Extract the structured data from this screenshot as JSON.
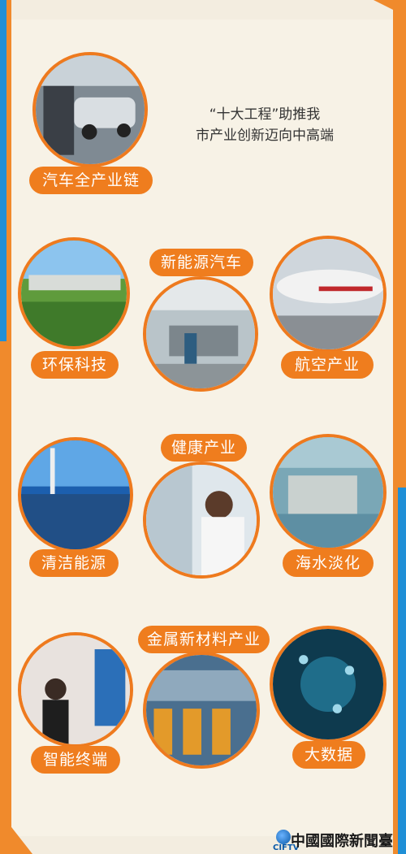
{
  "title": {
    "line1": "“十大工程”助推我",
    "line2": "市产业创新迈向中高端"
  },
  "items": [
    {
      "label": "汽车全产业链"
    },
    {
      "label": "环保科技"
    },
    {
      "label": "新能源汽车"
    },
    {
      "label": "航空产业"
    },
    {
      "label": "清洁能源"
    },
    {
      "label": "健康产业"
    },
    {
      "label": "海水淡化"
    },
    {
      "label": "智能终端"
    },
    {
      "label": "金属新材料产业"
    },
    {
      "label": "大数据"
    }
  ],
  "footer": {
    "brand": "中國國際新聞臺",
    "logo_text": "CIFTV"
  },
  "colors": {
    "accent": "#ee7a1e",
    "background": "#f7f2e6",
    "blue_stripe": "#1f8fd6"
  }
}
